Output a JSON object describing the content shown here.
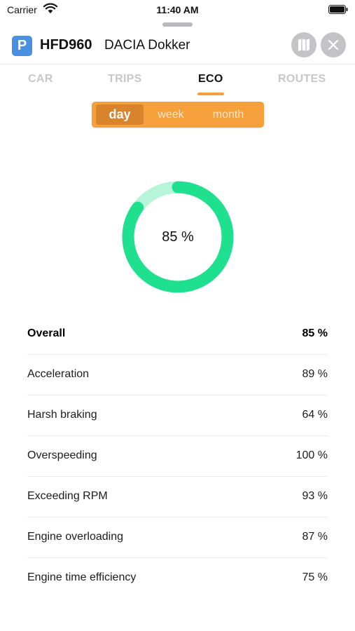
{
  "status_bar": {
    "carrier": "Carrier",
    "time": "11:40 AM"
  },
  "header": {
    "badge_letter": "P",
    "plate": "HFD960",
    "model": "DACIA Dokker",
    "map_icon": "map-icon",
    "close_icon": "close-icon"
  },
  "tabs": [
    {
      "label": "CAR",
      "active": false
    },
    {
      "label": "TRIPS",
      "active": false
    },
    {
      "label": "ECO",
      "active": true
    },
    {
      "label": "ROUTES",
      "active": false
    }
  ],
  "period": {
    "options": [
      "day",
      "week",
      "month"
    ],
    "selected": "day"
  },
  "eco_score": {
    "value": 85,
    "label": "85 %"
  },
  "scores": [
    {
      "name": "Overall",
      "value": "85 %",
      "bold": true
    },
    {
      "name": "Acceleration",
      "value": "89 %"
    },
    {
      "name": "Harsh braking",
      "value": "64 %"
    },
    {
      "name": "Overspeeding",
      "value": "100 %"
    },
    {
      "name": "Exceeding RPM",
      "value": "93 %"
    },
    {
      "name": "Engine overloading",
      "value": "87 %"
    },
    {
      "name": "Engine time efficiency",
      "value": "75 %"
    }
  ],
  "colors": {
    "accent": "#f6a03c",
    "accent_dark": "#d9832d",
    "donut_fill": "#1fe08f",
    "donut_track": "#b7f5d8",
    "badge": "#4a90e2"
  }
}
